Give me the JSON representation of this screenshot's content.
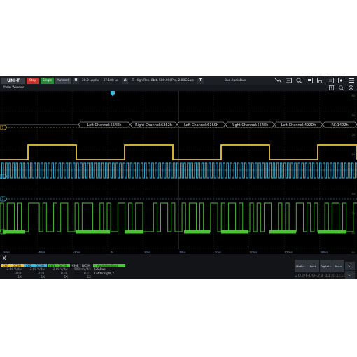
{
  "toolbar": {
    "logo": "UNI-T",
    "run_label": "Stop",
    "single_label": "Single",
    "autoset_label": "Autoset",
    "h_letter": "H",
    "timebase": "20.0 µs/div",
    "offset": "37.100 µs",
    "acq_letter": "A",
    "acq_info": "High Res.  8bit,  500.00kPts,  2.00GSa/s",
    "trig_letter": "T",
    "bus_info": "Bus  AudioBus"
  },
  "window": {
    "title": "Main Window"
  },
  "trigger_marker": "T",
  "decode_labels": [
    "Left Channel:554Eh",
    "Right Channel:6362h",
    "Left Channel:6160h",
    "Right Channel:554Eh",
    "Left Channel:492Dh",
    "RC:1402h"
  ],
  "channel_markers": {
    "ch1": "1",
    "ch2": "2",
    "ch3": "3"
  },
  "right_labels": [
    "80",
    "50",
    "20",
    "10",
    "0",
    "-10",
    "-20",
    "-50",
    "-80"
  ],
  "time_ticks": [
    "-90µs",
    "-60µs",
    "-30µs",
    "0s",
    "30µs",
    "60µs",
    "90µs",
    "120µs",
    "150µs",
    "180µs"
  ],
  "channels": [
    {
      "name": "CH1",
      "coupling": "DC1M",
      "scale": "2.00 V/div",
      "bw": "FULL",
      "probe": "1X",
      "color": "#e8c43a"
    },
    {
      "name": "CH2",
      "coupling": "DC1M",
      "scale": "2.00 V/div",
      "bw": "FULL",
      "probe": "1X",
      "color": "#3bb7e0"
    },
    {
      "name": "CH3",
      "coupling": "DC1M",
      "scale": "2.00 V/div",
      "bw": "FULL",
      "probe": "1X",
      "color": "#4cc236"
    },
    {
      "name": "CH4",
      "coupling": "DC1M",
      "scale": "500 mV/div",
      "bw": "FULL",
      "probe": "1X",
      "color": "#3a3d44"
    }
  ],
  "decode_panel": {
    "title": "AudioBus(Bus)",
    "line1": "I2S,Bus",
    "line2": "LeftOrRight,2"
  },
  "softkeys": [
    "Math+",
    "Ref+",
    "Digital+",
    "Bus+"
  ],
  "s1": "S1",
  "s2": "S2",
  "datetime": "2024-09-23  11:01:10",
  "x_icon": "X",
  "colors": {
    "ch1": "#e8c43a",
    "ch2": "#3bb7e0",
    "ch3": "#4cc236",
    "run": "#c8332c",
    "single": "#2a8a3a"
  }
}
